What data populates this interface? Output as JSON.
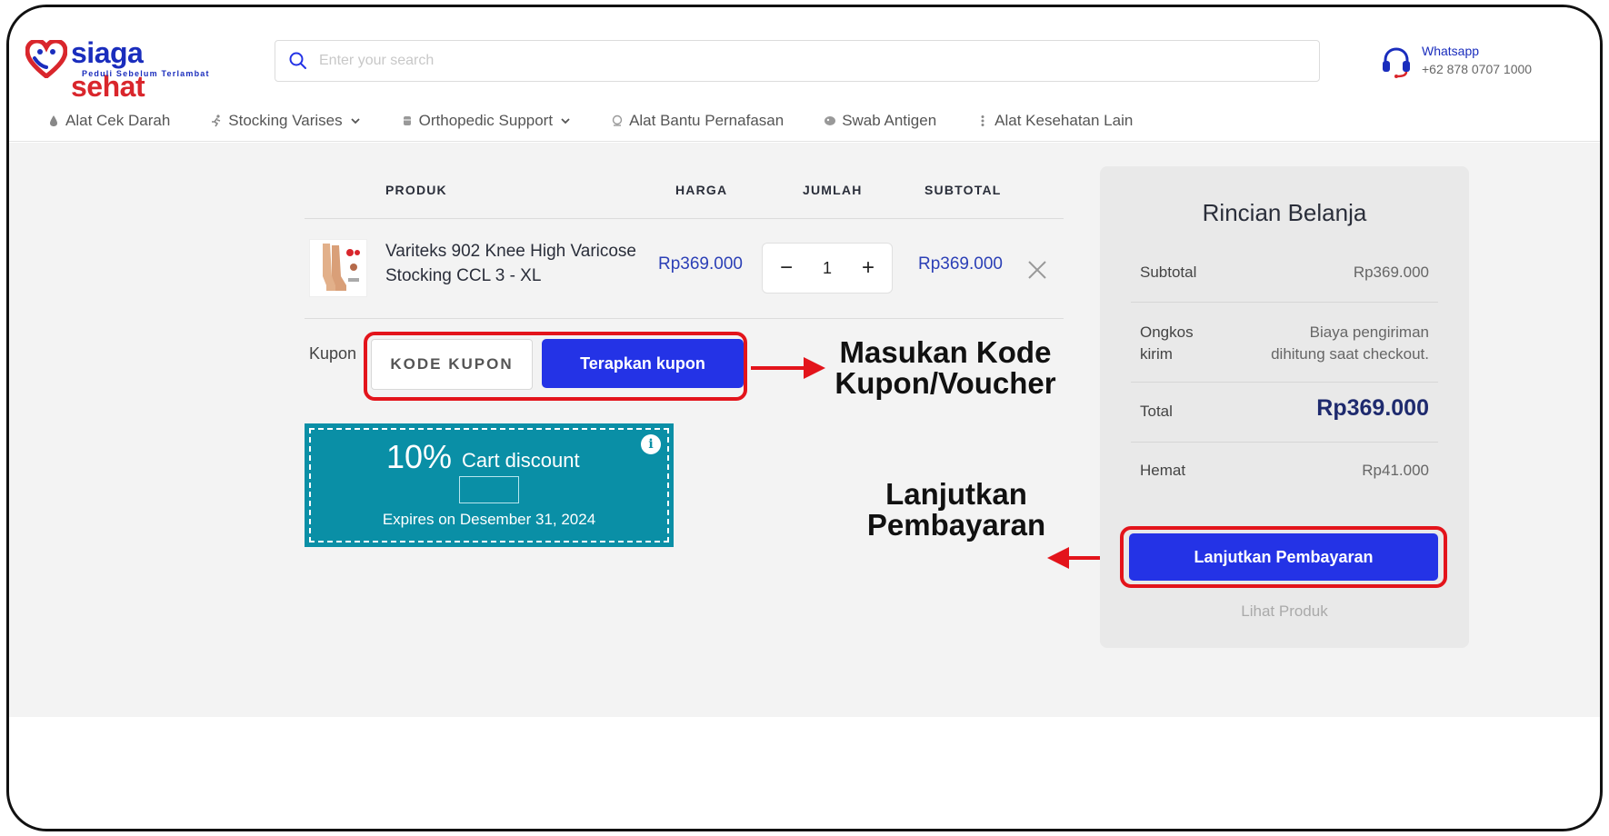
{
  "header": {
    "logo_name_a": "siaga",
    "logo_name_b": " sehat",
    "logo_tagline": "Peduli Sebelum Terlambat",
    "search_placeholder": "Enter your search",
    "whatsapp_label": "Whatsapp",
    "whatsapp_number": "+62 878 0707 1000"
  },
  "nav": [
    {
      "label": "Alat Cek Darah",
      "icon": "blood-drop-icon",
      "dropdown": false
    },
    {
      "label": "Stocking Varises",
      "icon": "runner-icon",
      "dropdown": true
    },
    {
      "label": "Orthopedic Support",
      "icon": "brace-icon",
      "dropdown": true
    },
    {
      "label": "Alat Bantu Pernafasan",
      "icon": "mask-icon",
      "dropdown": false
    },
    {
      "label": "Swab Antigen",
      "icon": "swab-icon",
      "dropdown": false
    },
    {
      "label": "Alat Kesehatan Lain",
      "icon": "dots-icon",
      "dropdown": false
    }
  ],
  "cart": {
    "col_product": "PRODUK",
    "col_price": "HARGA",
    "col_qty": "JUMLAH",
    "col_subtotal": "SUBTOTAL",
    "item": {
      "name": "Variteks 902 Knee High Varicose Stocking CCL 3 - XL",
      "price": "Rp369.000",
      "qty": "1",
      "subtotal": "Rp369.000",
      "minus": "−",
      "plus": "+"
    },
    "coupon_label": "Kupon",
    "coupon_placeholder": "KODE KUPON",
    "coupon_button": "Terapkan kupon"
  },
  "coupon_card": {
    "percent": "10%",
    "title": "Cart discount",
    "expires": "Expires on Desember 31, 2024",
    "info": "i",
    "color": "#0a8fa6"
  },
  "annotations": {
    "coupon_line1": "Masukan Kode",
    "coupon_line2": "Kupon/Voucher",
    "pay_line1": "Lanjutkan",
    "pay_line2": "Pembayaran",
    "highlight_color": "#e3141b"
  },
  "summary": {
    "title": "Rincian Belanja",
    "subtotal_label": "Subtotal",
    "subtotal_value": "Rp369.000",
    "shipping_label_1": "Ongkos",
    "shipping_label_2": "kirim",
    "shipping_value_1": "Biaya pengiriman",
    "shipping_value_2": "dihitung saat checkout.",
    "total_label": "Total",
    "total_value": "Rp369.000",
    "saving_label": "Hemat",
    "saving_value": "Rp41.000",
    "pay_button": "Lanjutkan Pembayaran",
    "view_products": "Lihat Produk"
  },
  "colors": {
    "brand_blue": "#1a2dbd",
    "brand_red": "#d9262c",
    "button_blue": "#2433e6"
  }
}
